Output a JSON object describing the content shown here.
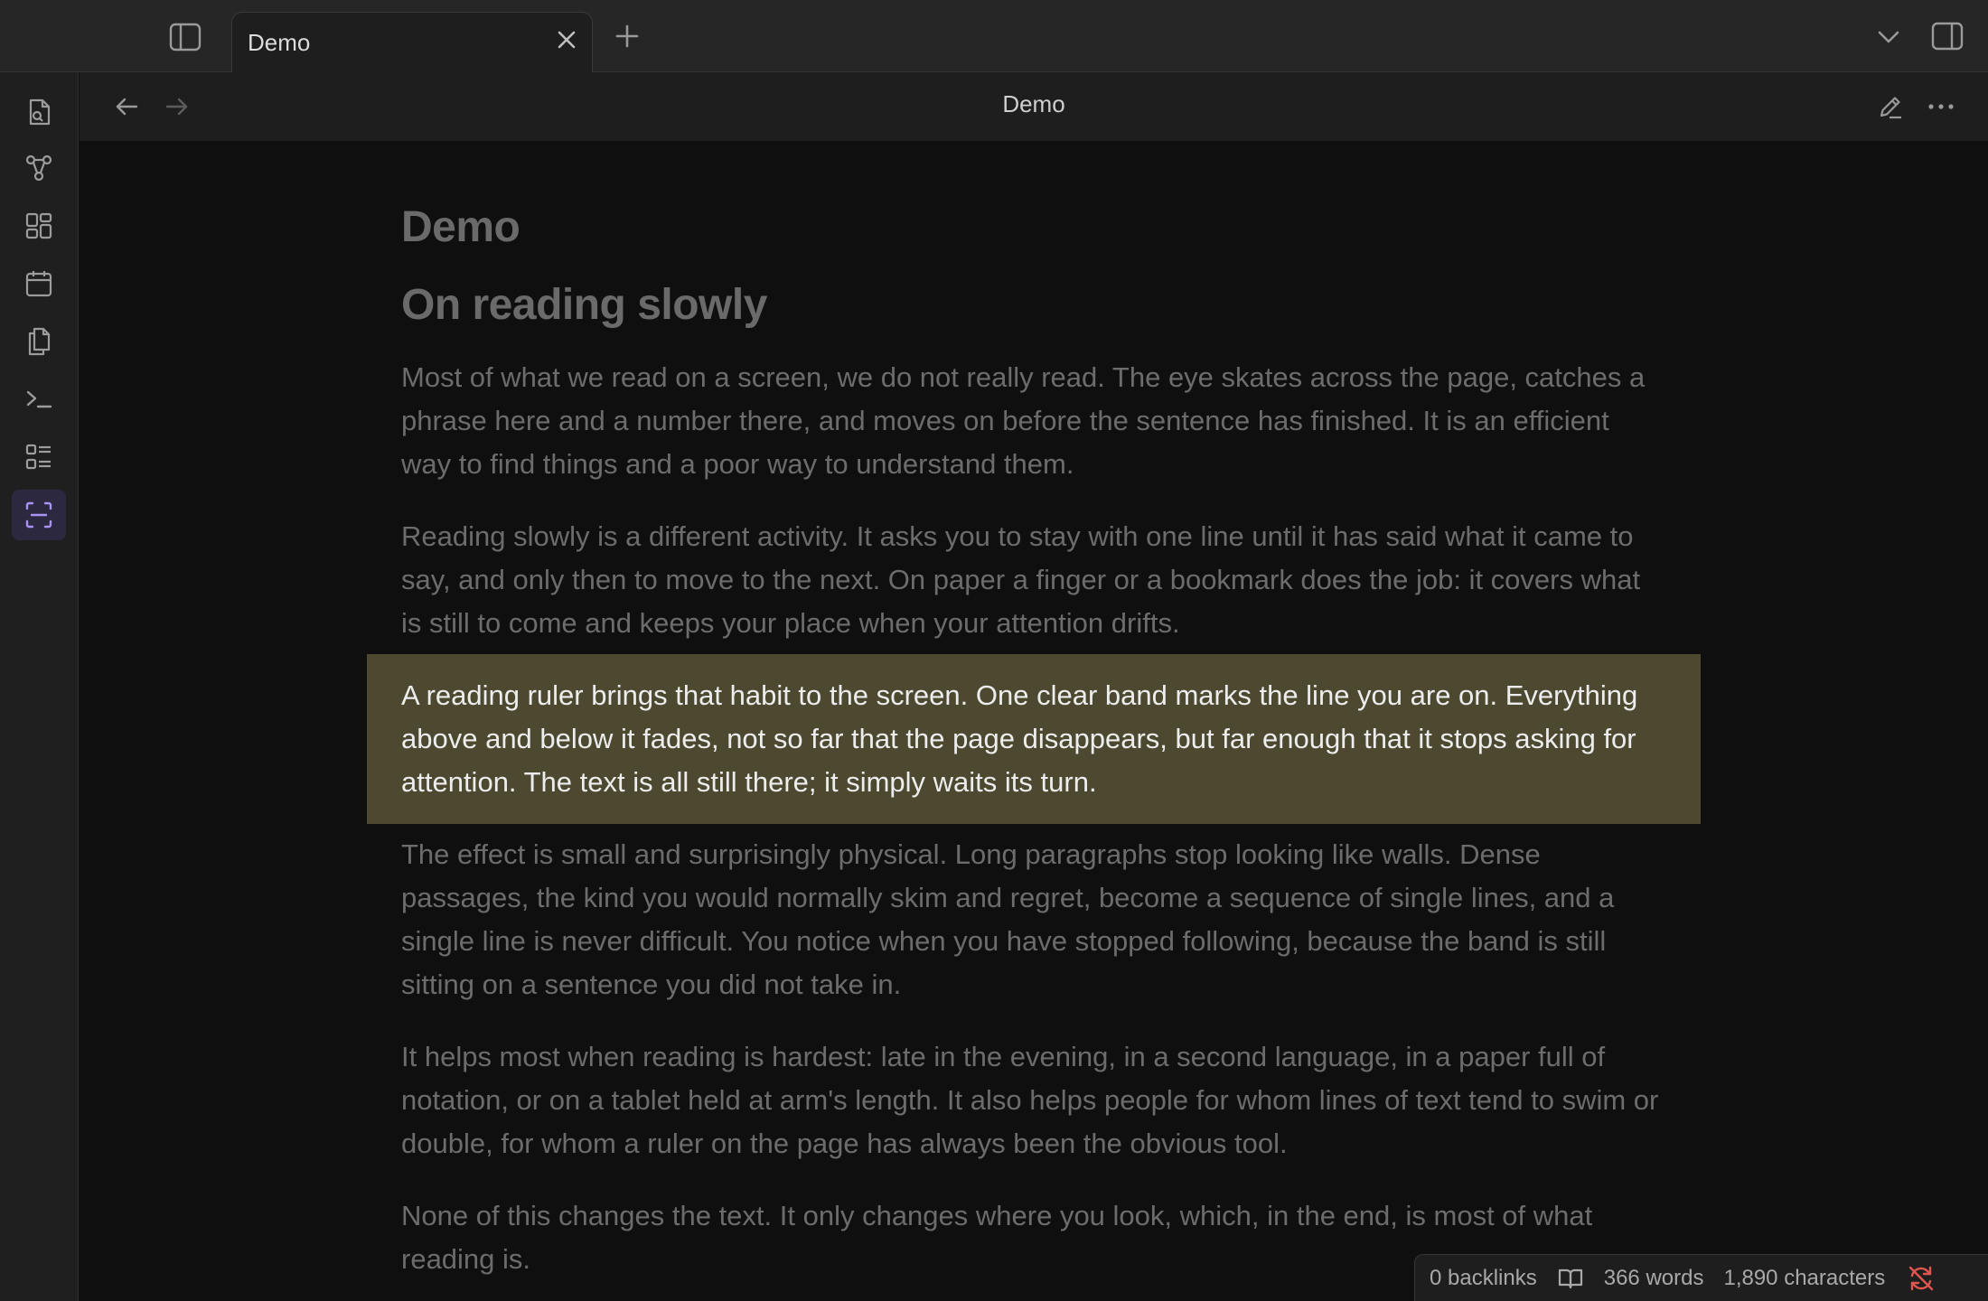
{
  "tabs": [
    {
      "title": "Demo",
      "active": true
    }
  ],
  "header": {
    "title": "Demo"
  },
  "ribbon": {
    "items": [
      {
        "name": "open-quick-switcher",
        "icon": "file-search-icon"
      },
      {
        "name": "open-graph-view",
        "icon": "graph-icon"
      },
      {
        "name": "open-canvas",
        "icon": "layout-dashboard-icon"
      },
      {
        "name": "open-daily-note",
        "icon": "calendar-icon"
      },
      {
        "name": "insert-template",
        "icon": "files-icon"
      },
      {
        "name": "open-command-palette",
        "icon": "terminal-icon"
      },
      {
        "name": "open-outline",
        "icon": "list-icon"
      },
      {
        "name": "toggle-reading-ruler",
        "icon": "scan-line-icon",
        "active": true
      }
    ]
  },
  "document": {
    "title": "Demo",
    "heading": "On reading slowly",
    "paragraphs": [
      "Most of what we read on a screen, we do not really read. The eye skates across the page, catches a phrase here and a number there, and moves on before the sentence has finished. It is an efficient way to find things and a poor way to understand them.",
      "Reading slowly is a different activity. It asks you to stay with one line until it has said what it came to say, and only then to move to the next. On paper a finger or a bookmark does the job: it covers what is still to come and keeps your place when your attention drifts.",
      "A reading ruler brings that habit to the screen. One clear band marks the line you are on. Everything above and below it fades, not so far that the page disappears, but far enough that it stops asking for attention. The text is all still there; it simply waits its turn.",
      "The effect is small and surprisingly physical. Long paragraphs stop looking like walls. Dense passages, the kind you would normally skim and regret, become a sequence of single lines, and a single line is never difficult. You notice when you have stopped following, because the band is still sitting on a sentence you did not take in.",
      "It helps most when reading is hardest: late in the evening, in a second language, in a paper full of notation, or on a tablet held at arm's length. It also helps people for whom lines of text tend to swim or double, for whom a ruler on the page has always been the obvious tool.",
      "None of this changes the text. It only changes where you look, which, in the end, is most of what reading is."
    ],
    "focused_paragraph_index": 2
  },
  "status": {
    "backlinks": "0 backlinks",
    "words": "366 words",
    "characters": "1,890 characters",
    "sync_state": "sync-error-icon"
  },
  "colors": {
    "ruler_band": "#4d4830",
    "active_accent": "#a893f5",
    "sync_error": "#e0564f"
  }
}
